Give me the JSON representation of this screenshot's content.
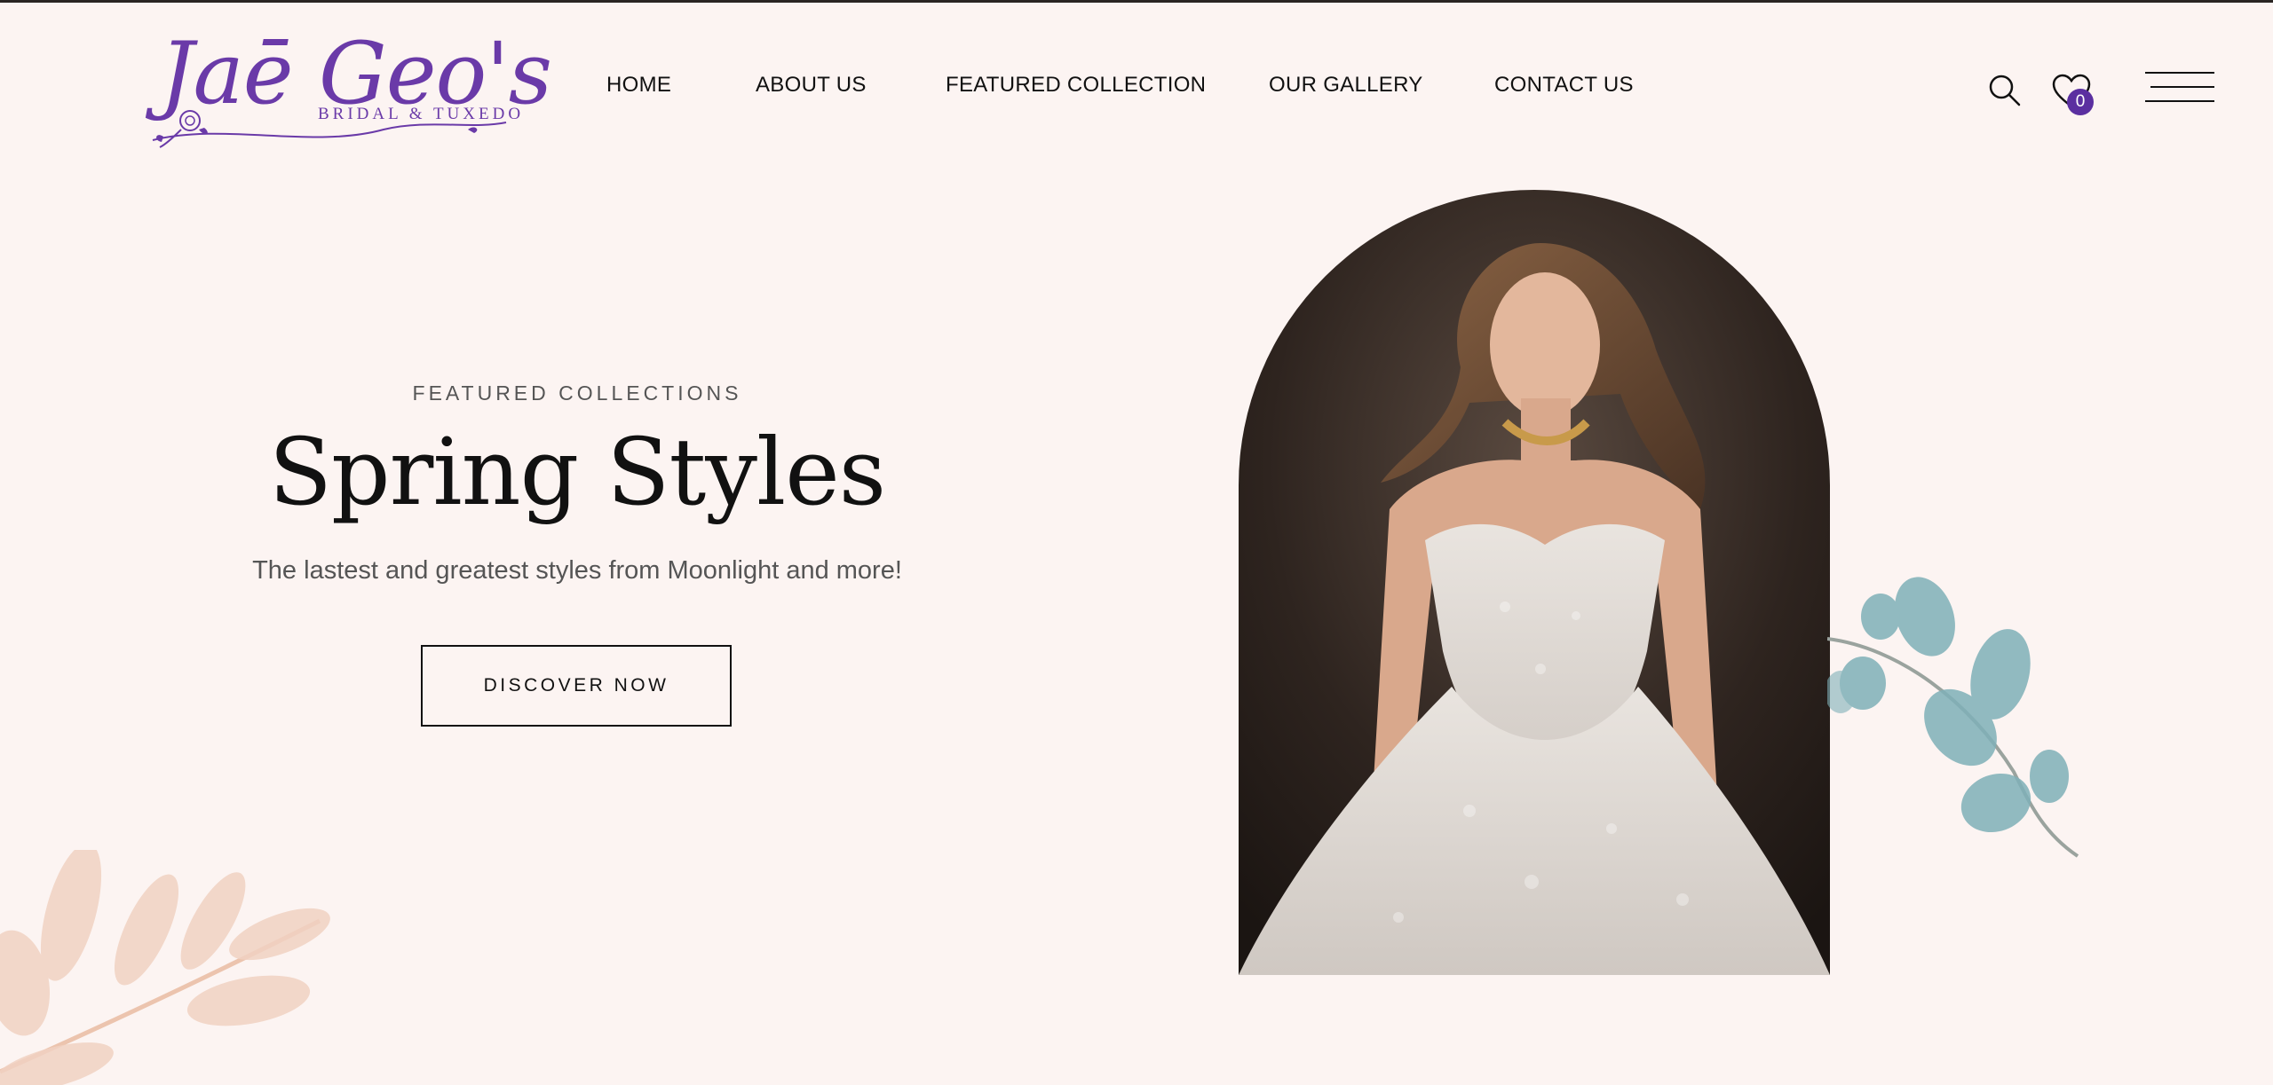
{
  "header": {
    "logo": {
      "script": "Jaē Geo's",
      "tagline": "BRIDAL & TUXEDO"
    },
    "nav": [
      {
        "label": "HOME"
      },
      {
        "label": "ABOUT US"
      },
      {
        "label": "FEATURED COLLECTION"
      },
      {
        "label": "OUR GALLERY"
      },
      {
        "label": "CONTACT US"
      }
    ],
    "wishlist_count": "0",
    "icons": [
      "search-icon",
      "heart-icon",
      "hamburger-menu-icon"
    ]
  },
  "hero": {
    "eyebrow": "FEATURED COLLECTIONS",
    "title": "Spring Styles",
    "subtitle": "The lastest and greatest styles from Moonlight and more!",
    "cta_label": "DISCOVER NOW"
  },
  "colors": {
    "background": "#fcf4f2",
    "brand_purple": "#6a3aa8",
    "badge": "#5b2fa0",
    "text": "#111111",
    "muted": "#555555",
    "eucalyptus": "#7fb0b8",
    "peach_leaf": "#f1d2c2"
  }
}
